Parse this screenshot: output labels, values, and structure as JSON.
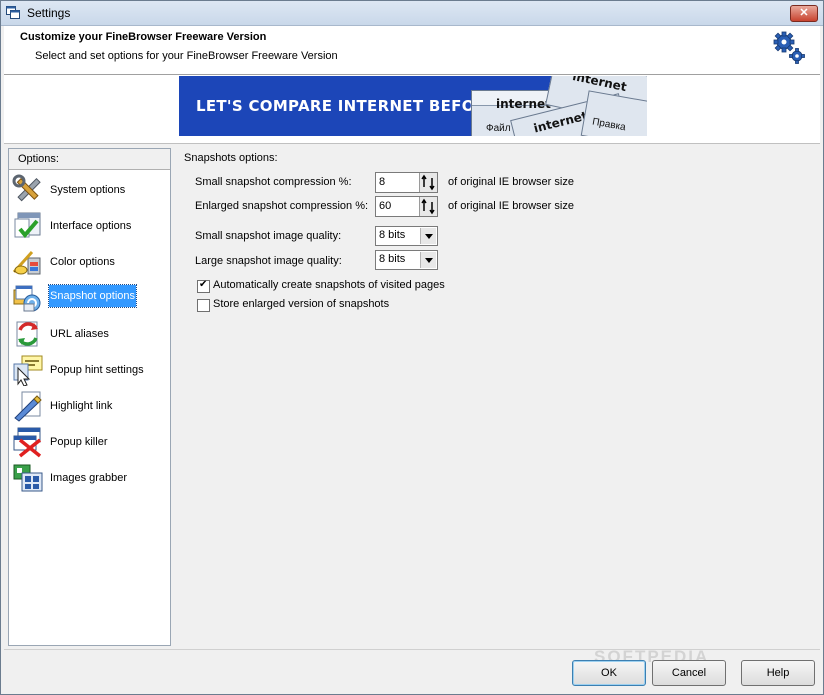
{
  "window": {
    "title": "Settings",
    "close_label": "✕"
  },
  "header": {
    "title": "Customize your FineBrowser Freeware Version",
    "subtitle": "Select and set options for your FineBrowser Freeware Version"
  },
  "banner": {
    "headline": "LET'S COMPARE INTERNET BEFORE",
    "card_text": "internet",
    "menu_text_1": "Файл",
    "menu_text_2": "Правка"
  },
  "sidebar": {
    "header": "Options:",
    "items": [
      {
        "label": "System options",
        "icon": "tools-icon"
      },
      {
        "label": "Interface options",
        "icon": "interface-checkmark-icon"
      },
      {
        "label": "Color options",
        "icon": "palette-icon"
      },
      {
        "label": "Snapshot options",
        "icon": "snapshot-icon",
        "selected": true
      },
      {
        "label": "URL aliases",
        "icon": "refresh-arrows-icon"
      },
      {
        "label": "Popup hint settings",
        "icon": "popup-hint-icon"
      },
      {
        "label": "Highlight link",
        "icon": "highlighter-icon"
      },
      {
        "label": "Popup killer",
        "icon": "popup-killer-icon"
      },
      {
        "label": "Images grabber",
        "icon": "images-grabber-icon"
      }
    ]
  },
  "snapshot": {
    "section_title": "Snapshots options:",
    "small_compression_label": "Small snapshot compression %:",
    "small_compression_value": "8",
    "enlarged_compression_label": "Enlarged snapshot compression %:",
    "enlarged_compression_value": "60",
    "compression_suffix": "of original IE browser size",
    "small_quality_label": "Small snapshot image quality:",
    "small_quality_value": "8 bits",
    "large_quality_label": "Large snapshot image quality:",
    "large_quality_value": "8 bits",
    "auto_create_label": "Automatically create snapshots of visited pages",
    "auto_create_checked": true,
    "store_enlarged_label": "Store enlarged version of snapshots",
    "store_enlarged_checked": false
  },
  "buttons": {
    "ok": "OK",
    "cancel": "Cancel",
    "help": "Help"
  },
  "watermark": "SOFTPEDIA"
}
